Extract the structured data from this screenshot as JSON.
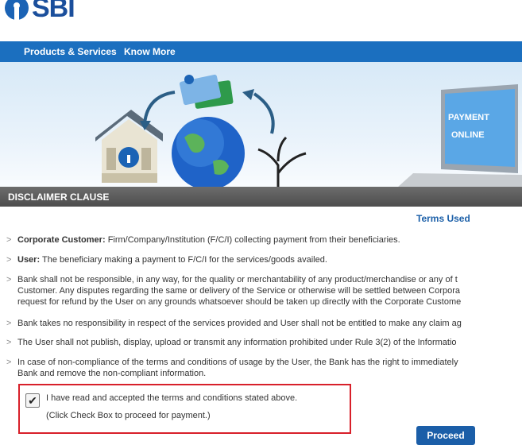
{
  "brand": {
    "logo_text": "SBI"
  },
  "nav": {
    "items": [
      {
        "label": "Products & Services"
      },
      {
        "label": "Know More"
      }
    ]
  },
  "banner": {
    "laptop_text_line1": "PAYMENT",
    "laptop_text_line2": "ONLINE"
  },
  "disclaimer": {
    "title": "DISCLAIMER CLAUSE"
  },
  "terms_heading": "Terms Used",
  "terms": [
    {
      "term": "Corporate Customer:",
      "lines": [
        "Firm/Company/Institution (F/C/I) collecting payment from their beneficiaries."
      ]
    },
    {
      "term": "User:",
      "lines": [
        "The beneficiary making a payment to F/C/I for the services/goods availed."
      ]
    },
    {
      "term": "",
      "lines": [
        "Bank shall not be responsible, in any way, for the quality or merchantability of any product/merchandise or any of t",
        "Customer. Any disputes regarding the same or delivery of the Service or otherwise will be settled between Corpora",
        "request for refund by the User on any grounds whatsoever should be taken up directly with the Corporate Custome"
      ]
    },
    {
      "term": "",
      "lines": [
        "Bank takes no responsibility in respect of the services provided and User shall not be entitled to make any claim ag"
      ]
    },
    {
      "term": "",
      "lines": [
        "The User shall not publish, display, upload or transmit any information prohibited under Rule 3(2) of the Informatio"
      ]
    },
    {
      "term": "",
      "lines": [
        "In case of non-compliance of the terms and conditions of usage by the User, the Bank has the right to immediately",
        "Bank and remove the non-compliant information."
      ]
    }
  ],
  "consent": {
    "checked": true,
    "check_glyph": "✔",
    "text": "I have read and accepted the terms and conditions stated above.",
    "hint": "(Click Check Box to proceed for payment.)"
  },
  "proceed_label": "Proceed",
  "colors": {
    "nav_blue": "#1b6fbf",
    "link_blue": "#1b5fa8",
    "highlight_red": "#d8202a",
    "bar_gray": "#5a5a5a"
  }
}
